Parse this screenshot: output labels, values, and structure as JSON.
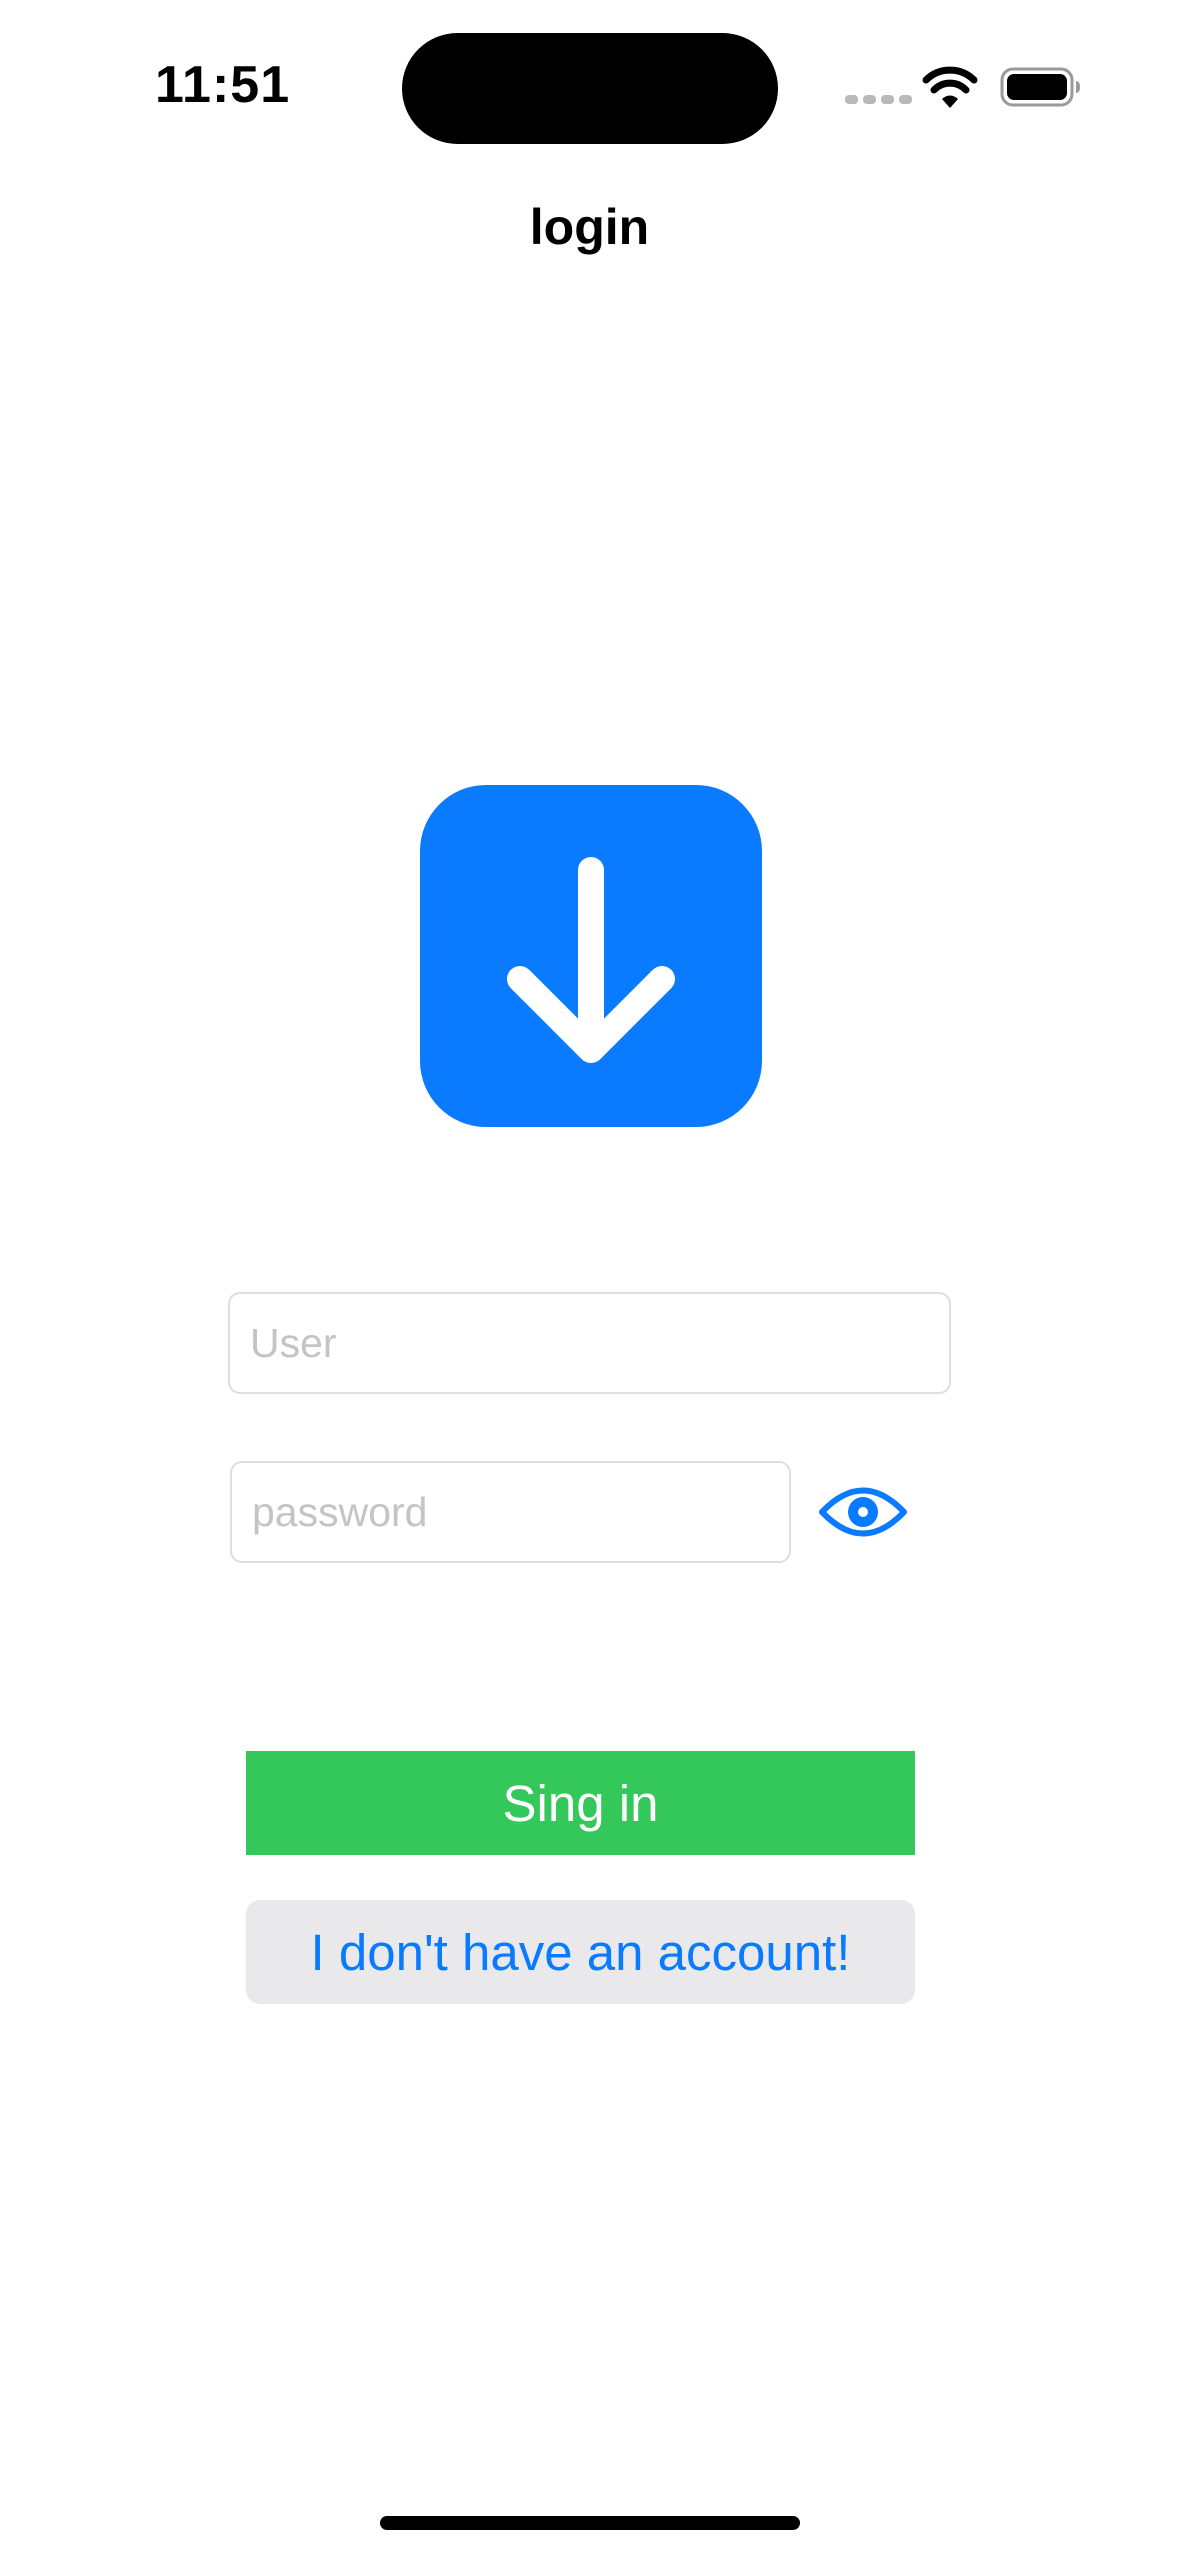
{
  "status_bar": {
    "time": "11:51",
    "icons": [
      "cellular-signal-icon",
      "wifi-icon",
      "battery-icon"
    ]
  },
  "nav": {
    "title": "login"
  },
  "logo": {
    "icon": "arrow-down-square-icon",
    "color": "#0A7AFF"
  },
  "form": {
    "user_placeholder": "User",
    "user_value": "",
    "password_placeholder": "password",
    "password_value": "",
    "visibility_icon": "eye-icon"
  },
  "buttons": {
    "sign_in_label": "Sing in",
    "no_account_label": "I don't have an account!"
  },
  "colors": {
    "accent": "#0A7AFF",
    "sign_in_bg": "#34C85A",
    "secondary_bg": "#E9E9EB"
  }
}
